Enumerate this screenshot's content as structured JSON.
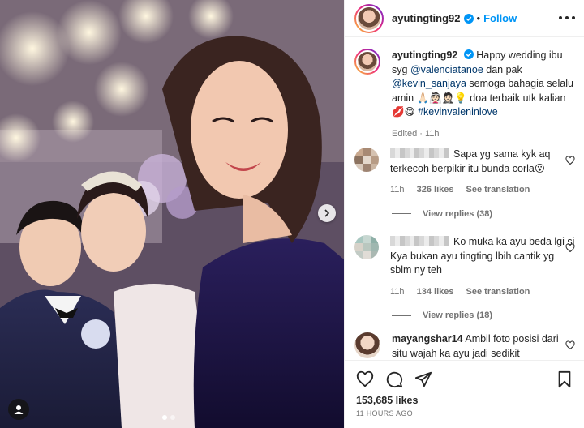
{
  "post": {
    "username": "ayutingting92",
    "follow_label": "Follow",
    "dot": "•",
    "caption_pre": "Happy wedding ibu syg ",
    "caption_mention1": "@valenciatanoe",
    "caption_mid": " dan pak ",
    "caption_mention2": "@kevin_sanjaya",
    "caption_post": " semoga bahagia selalu amin 🙏🏻👰🏻🤵🏻💡 doa terbaik utk kalian 💋😋 ",
    "caption_hashtag": "#kevinvaleninlove",
    "caption_meta": "Edited · 11h"
  },
  "comments": [
    {
      "text": "Sapa yg sama kyk aq terkecoh berpikir itu bunda corla😮",
      "time": "11h",
      "likes": "326 likes",
      "translate": "See translation",
      "replies": "View replies (38)"
    },
    {
      "text": "Ko muka ka ayu beda lgi si Kya bukan ayu tingting lbih cantik yg sblm ny teh",
      "time": "11h",
      "likes": "134 likes",
      "translate": "See translation",
      "replies": "View replies (18)"
    },
    {
      "user": "mayangshar14",
      "text": "Ambil foto posisi dari situ wajah ka ayu jadi sedikit"
    }
  ],
  "footer": {
    "likes": "153,685 likes",
    "time": "11 HOURS AGO"
  },
  "colors": {
    "accent": "#0095f6",
    "link": "#00376b",
    "muted": "#737373"
  },
  "icons": [
    "verified-icon",
    "more-icon",
    "heart-icon",
    "comment-icon",
    "share-icon",
    "bookmark-icon",
    "chevron-right-icon",
    "user-tag-icon"
  ]
}
